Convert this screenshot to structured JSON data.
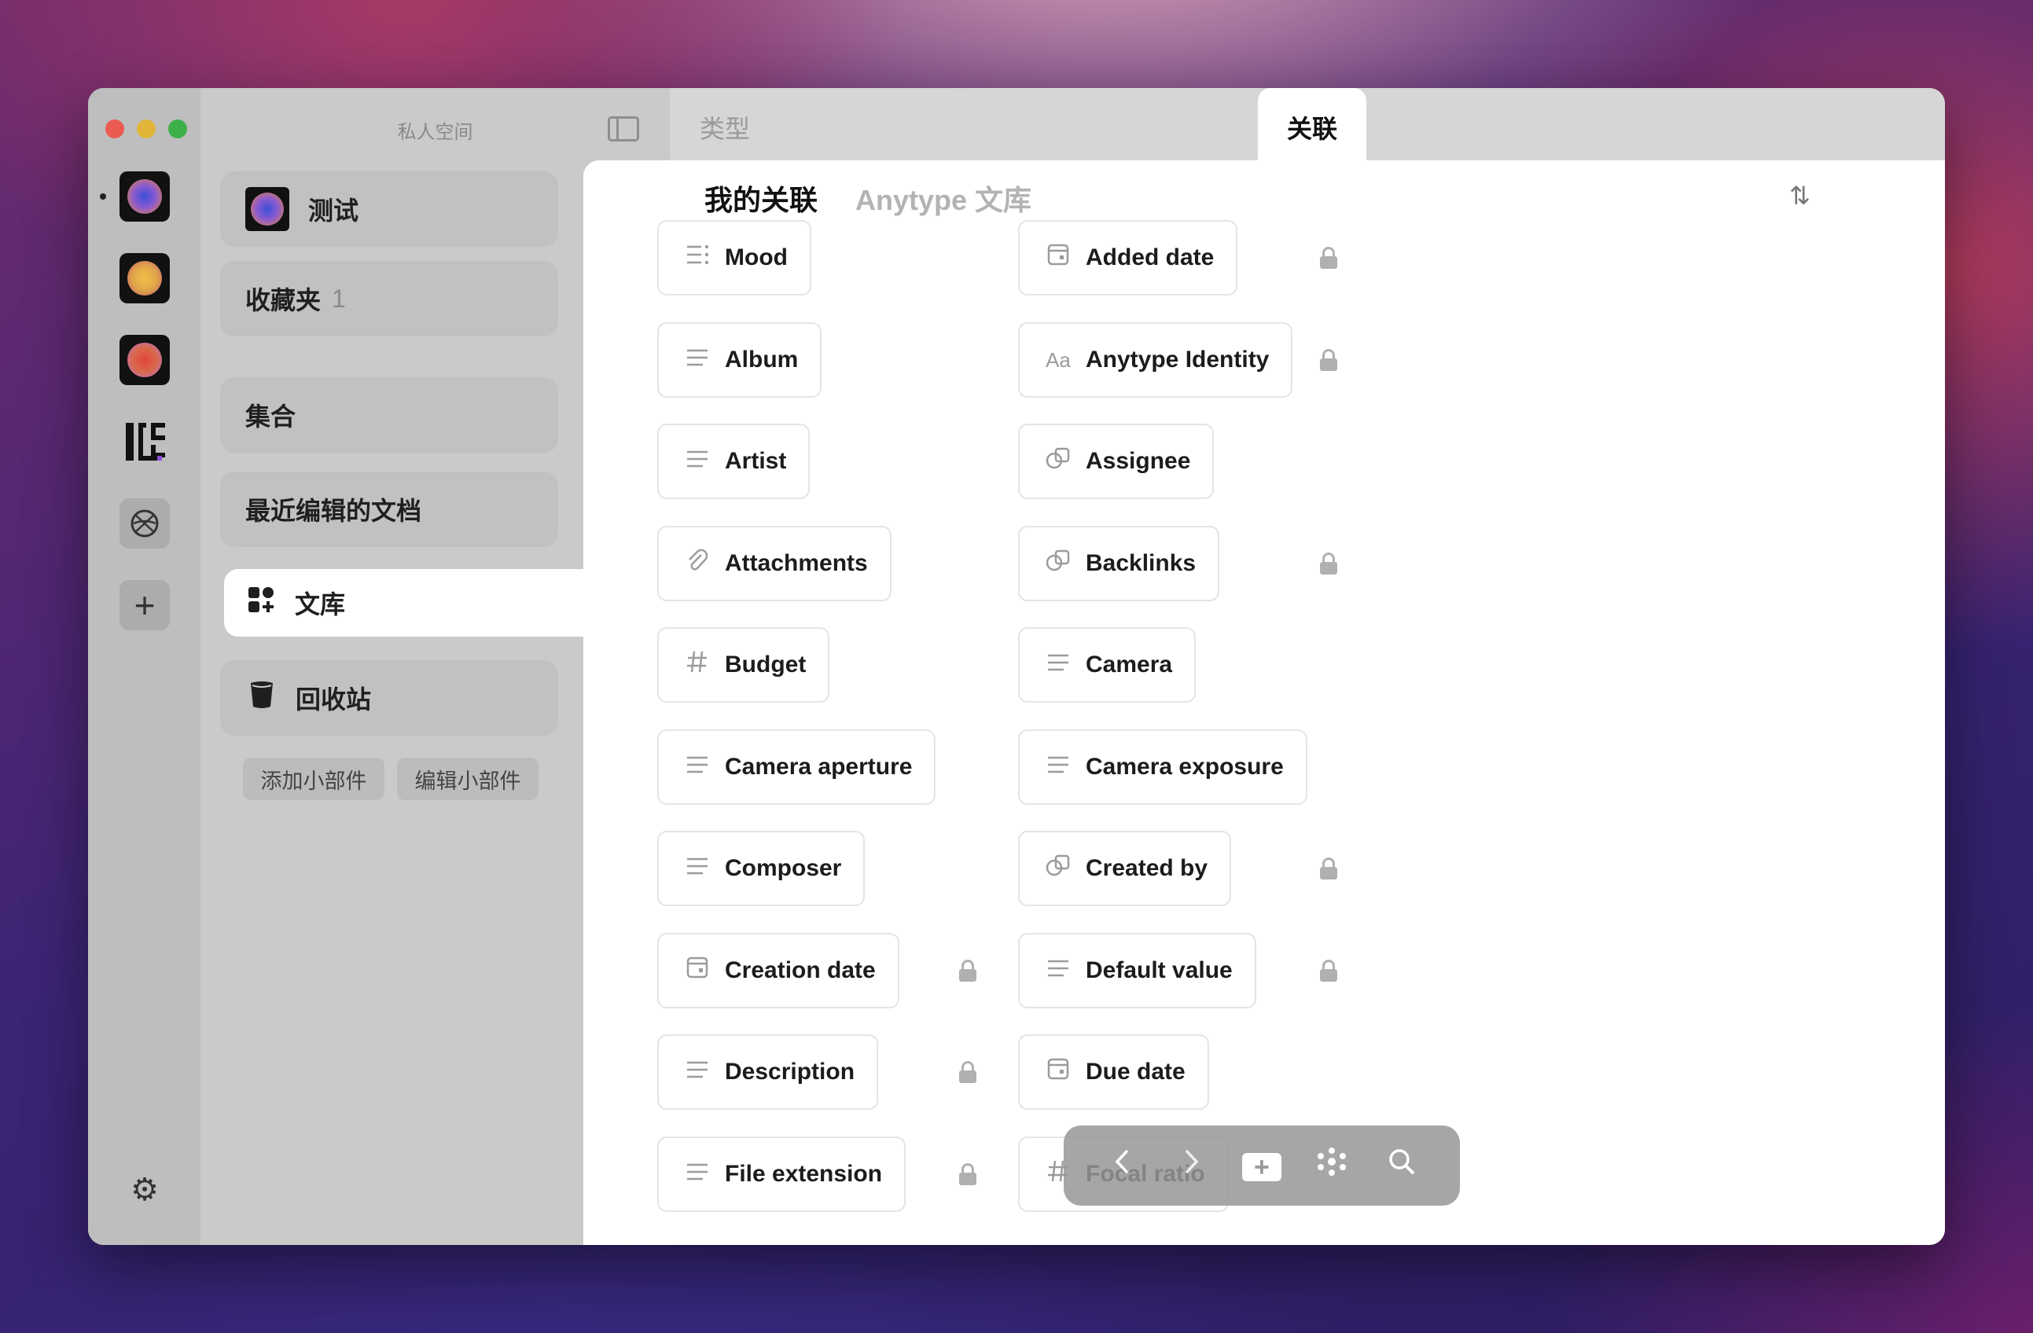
{
  "sidebar": {
    "title": "私人空间",
    "widgets": [
      {
        "label": "测试"
      },
      {
        "label": "收藏夹",
        "count": "1"
      },
      {
        "label": "集合"
      },
      {
        "label": "最近编辑的文档"
      },
      {
        "label": "文库"
      },
      {
        "label": "回收站"
      }
    ],
    "add_widget": "添加小部件",
    "edit_widget": "编辑小部件"
  },
  "tabs": {
    "types": "类型",
    "relations": "关联"
  },
  "subtabs": {
    "mine": "我的关联",
    "library": "Anytype 文库"
  },
  "relations_left": [
    {
      "label": "Mood",
      "icon": "multi-select-icon",
      "locked": false
    },
    {
      "label": "Album",
      "icon": "text-icon",
      "locked": false
    },
    {
      "label": "Artist",
      "icon": "text-icon",
      "locked": false
    },
    {
      "label": "Attachments",
      "icon": "paperclip-icon",
      "locked": false
    },
    {
      "label": "Budget",
      "icon": "number-icon",
      "locked": false
    },
    {
      "label": "Camera aperture",
      "icon": "text-icon",
      "locked": false
    },
    {
      "label": "Composer",
      "icon": "text-icon",
      "locked": false
    },
    {
      "label": "Creation date",
      "icon": "date-icon",
      "locked": true
    },
    {
      "label": "Description",
      "icon": "text-icon",
      "locked": true
    },
    {
      "label": "File extension",
      "icon": "text-icon",
      "locked": true
    }
  ],
  "relations_right": [
    {
      "label": "Added date",
      "icon": "date-icon",
      "locked": true
    },
    {
      "label": "Anytype Identity",
      "icon": "font-icon",
      "locked": true
    },
    {
      "label": "Assignee",
      "icon": "object-icon",
      "locked": false
    },
    {
      "label": "Backlinks",
      "icon": "object-icon",
      "locked": true
    },
    {
      "label": "Camera",
      "icon": "text-icon",
      "locked": false
    },
    {
      "label": "Camera exposure",
      "icon": "text-icon",
      "locked": false
    },
    {
      "label": "Created by",
      "icon": "object-icon",
      "locked": true
    },
    {
      "label": "Default value",
      "icon": "text-icon",
      "locked": true
    },
    {
      "label": "Due date",
      "icon": "date-icon",
      "locked": false
    },
    {
      "label": "Focal ratio",
      "icon": "number-icon",
      "locked": false
    }
  ],
  "help": "?"
}
